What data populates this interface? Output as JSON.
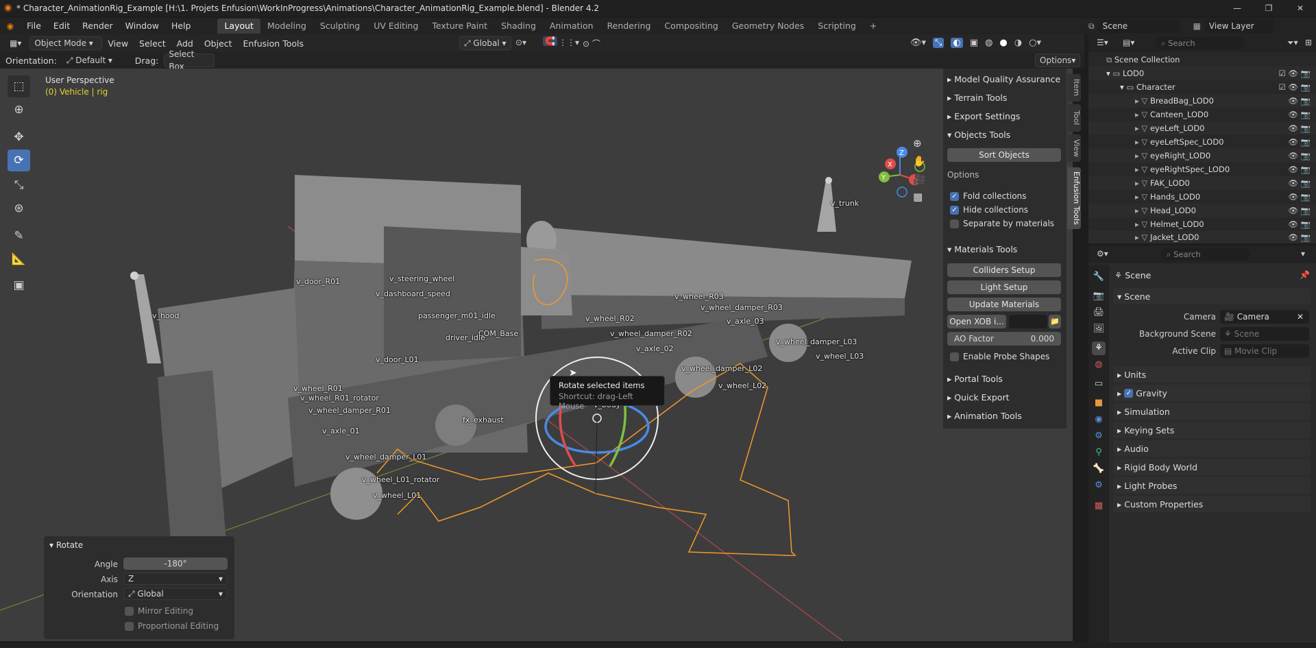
{
  "window": {
    "title": "* Character_AnimationRig_Example [H:\\1. Projets Enfusion\\WorkInProgress\\Animations\\Character_AnimationRig_Example.blend] - Blender 4.2",
    "minimize": "—",
    "maximize": "❐",
    "close": "✕"
  },
  "menubar": {
    "items": [
      "File",
      "Edit",
      "Render",
      "Window",
      "Help"
    ],
    "workspaces": [
      "Layout",
      "Modeling",
      "Sculpting",
      "UV Editing",
      "Texture Paint",
      "Shading",
      "Animation",
      "Rendering",
      "Compositing",
      "Geometry Nodes",
      "Scripting"
    ],
    "active_workspace": "Layout",
    "add_workspace": "+",
    "scene_name": "Scene",
    "view_layer": "View Layer"
  },
  "viewport_header": {
    "mode": "Object Mode",
    "menus": [
      "View",
      "Select",
      "Add",
      "Object",
      "Enfusion Tools"
    ],
    "transform_orientation": "Global",
    "orientation_label": "Orientation:",
    "orientation_value": "Default",
    "drag_label": "Drag:",
    "drag_value": "Select Box",
    "options": "Options"
  },
  "viewport": {
    "perspective": "User Perspective",
    "object_info": "(0) Vehicle | rig",
    "bone_labels": [
      "v_hood",
      "v_door_R01",
      "v_steering_wheel",
      "v_dashboard_speed",
      "passenger_m01_idle",
      "COM_Base",
      "driver_idle",
      "v_door_L01",
      "v_wheel_R01",
      "v_wheel_R01_rotator",
      "v_wheel_damper_R01",
      "v_axle_01",
      "fx_exhaust",
      "v_wheel_damper_L01",
      "v_wheel_L01_rotator",
      "v_wheel_L01",
      "v_wheel_R02",
      "v_wheel_damper_R02",
      "v_axle_02",
      "v_wheel_R03",
      "v_wheel_damper_R03",
      "v_axle_03",
      "v_wheel_damper_L03",
      "v_wheel_L03",
      "v_wheel_damper_L02",
      "v_wheel_L02",
      "v_trunk",
      "v_body"
    ],
    "tooltip_title": "Rotate selected items",
    "tooltip_shortcut": "Shortcut: drag-Left Mouse",
    "gizmo_axes": [
      "Z",
      "X",
      "Y"
    ]
  },
  "npanel": {
    "tabs": [
      "Item",
      "Tool",
      "View",
      "Enfusion Tools"
    ],
    "active_tab": "Enfusion Tools",
    "sections": {
      "model_qa": "Model Quality Assurance",
      "terrain": "Terrain Tools",
      "export": "Export Settings",
      "objects": "Objects Tools",
      "sort_objects": "Sort Objects",
      "options_label": "Options",
      "fold_collections": "Fold collections",
      "hide_collections": "Hide collections",
      "separate_by_materials": "Separate by materials",
      "materials": "Materials Tools",
      "colliders_setup": "Colliders Setup",
      "light_setup": "Light Setup",
      "update_materials": "Update Materials",
      "open_xob": "Open XOB i...",
      "ao_factor_label": "AO Factor",
      "ao_factor_value": "0.000",
      "enable_probe_shapes": "Enable Probe Shapes",
      "portal": "Portal Tools",
      "quick_export": "Quick Export",
      "animation": "Animation Tools"
    }
  },
  "rotate_panel": {
    "title": "Rotate",
    "angle_label": "Angle",
    "angle_value": "-180°",
    "axis_label": "Axis",
    "axis_value": "Z",
    "orientation_label": "Orientation",
    "orientation_value": "Global",
    "mirror_editing": "Mirror Editing",
    "proportional_editing": "Proportional Editing"
  },
  "outliner": {
    "search_placeholder": "Search",
    "scene_collection": "Scene Collection",
    "lod0": "LOD0",
    "character": "Character",
    "objects": [
      "BreadBag_LOD0",
      "Canteen_LOD0",
      "eyeLeft_LOD0",
      "eyeLeftSpec_LOD0",
      "eyeRight_LOD0",
      "eyeRightSpec_LOD0",
      "FAK_LOD0",
      "Hands_LOD0",
      "Head_LOD0",
      "Helmet_LOD0",
      "Jacket_LOD0"
    ]
  },
  "properties": {
    "search_placeholder": "Search",
    "context": "Scene",
    "scene_panel": "Scene",
    "camera_label": "Camera",
    "camera_value": "Camera",
    "background_scene_label": "Background Scene",
    "background_scene_placeholder": "Scene",
    "active_clip_label": "Active Clip",
    "active_clip_placeholder": "Movie Clip",
    "sections": [
      "Units",
      "Gravity",
      "Simulation",
      "Keying Sets",
      "Audio",
      "Rigid Body World",
      "Light Probes",
      "Custom Properties"
    ]
  },
  "colors": {
    "accent_blue": "#4772b3",
    "selection_orange": "#f39a2b",
    "x_axis": "#e04c4c",
    "y_axis": "#7fbf3f",
    "z_axis": "#4a8ae8"
  }
}
